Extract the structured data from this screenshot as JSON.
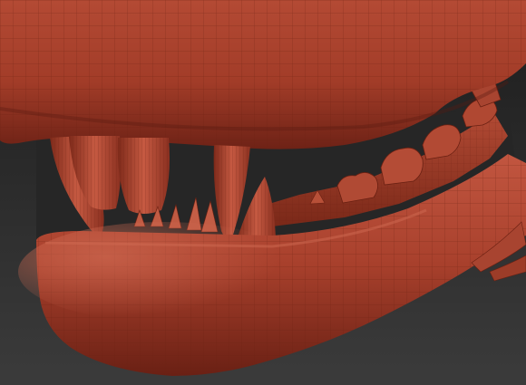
{
  "viewport": {
    "subject": "sculpted-creature-jaw-wireframe-render"
  },
  "colors": {
    "background_top": "#1c1c1c",
    "background_bottom": "#3a3a3a",
    "clay_base": "#a8402c",
    "clay_light": "#c85a44",
    "clay_dark": "#6e2216",
    "clay_shadow": "#4a1810",
    "wire": "#7a2a1c",
    "mouth_interior": "#262626"
  }
}
